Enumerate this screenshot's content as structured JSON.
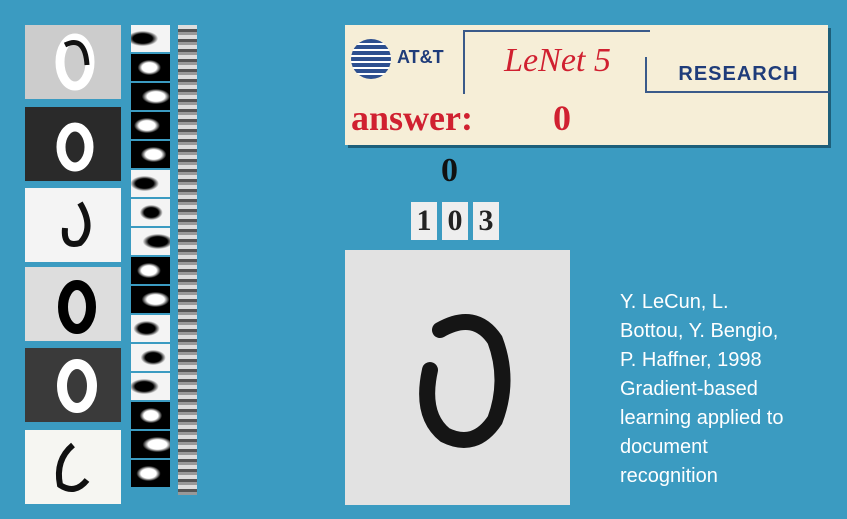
{
  "banner": {
    "logo_text": "AT&T",
    "title": "LeNet 5",
    "research_label": "RESEARCH",
    "answer_label": "answer:",
    "answer_value": "0"
  },
  "prediction": {
    "top_digit": "0",
    "candidates": [
      "1",
      "0",
      "3"
    ]
  },
  "credit": {
    "lines": [
      "Y. LeCun, L.",
      "Bottou, Y. Bengio,",
      "P. Haffner, 1998",
      "Gradient-based",
      "learning applied to",
      "document",
      "recognition"
    ]
  },
  "colors": {
    "background": "#3b9bc1",
    "banner": "#f6eed7",
    "accent_red": "#d02030",
    "research_blue": "#1f3c7a"
  }
}
